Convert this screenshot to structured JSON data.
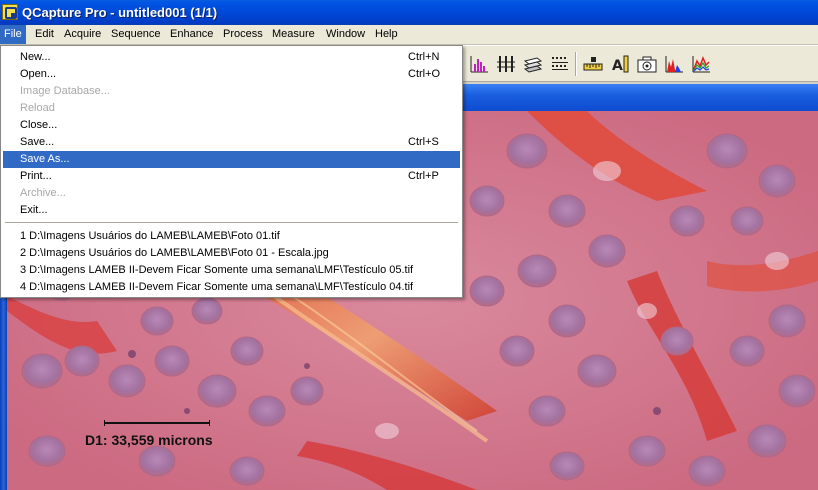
{
  "window": {
    "title": "QCapture Pro - untitled001 (1/1)"
  },
  "menubar": {
    "items": [
      {
        "label": "File",
        "active": true
      },
      {
        "label": "Edit"
      },
      {
        "label": "Acquire"
      },
      {
        "label": "Sequence"
      },
      {
        "label": "Enhance"
      },
      {
        "label": "Process"
      },
      {
        "label": "Measure"
      },
      {
        "label": "Window"
      },
      {
        "label": "Help"
      }
    ]
  },
  "toolbar": {
    "icons": [
      "histogram-plot-icon",
      "vertical-lines-icon",
      "layers-icon",
      "grid-dots-icon",
      "ruler-icon",
      "text-annotation-icon",
      "camera-icon",
      "color-histogram-icon",
      "line-profile-icon"
    ]
  },
  "file_menu": {
    "items": [
      {
        "label": "New...",
        "shortcut": "Ctrl+N"
      },
      {
        "label": "Open...",
        "shortcut": "Ctrl+O"
      },
      {
        "label": "Image Database...",
        "disabled": true
      },
      {
        "label": "Reload",
        "disabled": true
      },
      {
        "label": "Close..."
      },
      {
        "label": "Save...",
        "shortcut": "Ctrl+S"
      },
      {
        "label": "Save As...",
        "highlighted": true
      },
      {
        "label": "Print...",
        "shortcut": "Ctrl+P"
      },
      {
        "label": "Archive...",
        "disabled": true
      },
      {
        "label": "Exit..."
      }
    ],
    "recent_files": [
      "1 D:\\Imagens Usuários do LAMEB\\LAMEB\\Foto 01.tif",
      "2 D:\\Imagens Usuários do LAMEB\\LAMEB\\Foto 01 - Escala.jpg",
      "3 D:\\Imagens LAMEB II-Devem Ficar Somente uma semana\\LMF\\Testículo 05.tif",
      "4 D:\\Imagens LAMEB II-Devem Ficar Somente uma semana\\LMF\\Testículo 04.tif"
    ]
  },
  "image": {
    "measurement_label": "D1:  33,559 microns"
  },
  "colors": {
    "highlight": "#316ac5",
    "title_bar": "#0048d8",
    "menu_bg": "#ece9d8"
  }
}
